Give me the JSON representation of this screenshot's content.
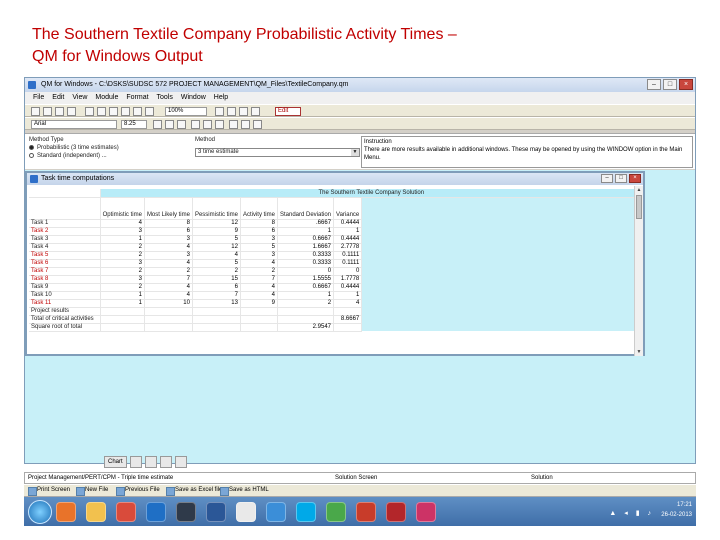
{
  "slide": {
    "title_line1": "The Southern Textile Company  Probabilistic Activity Times –",
    "title_line2": "QM for Windows Output"
  },
  "window": {
    "title": "QM for Windows - C:\\DSKS\\SUDSC 572 PROJECT MANAGEMENT\\QM_Files\\TextileCompany.qm"
  },
  "menu": [
    "File",
    "Edit",
    "View",
    "Module",
    "Format",
    "Tools",
    "Window",
    "Help"
  ],
  "toolbar": {
    "font_size": "100%",
    "font_name": "Arial",
    "font_pt": "8.25",
    "edit_label": "Edit"
  },
  "options": {
    "method_label": "Method Type",
    "radio1": "Probabilistic (3 time estimates)",
    "radio2": "Standard (independent) ...",
    "method_section_label": "Method",
    "method_value": "3 time estimate",
    "instruction_label": "Instruction",
    "instruction_text": "There are more results available in additional windows. These may be opened by using the WINDOW option in the Main Menu."
  },
  "inner_window": {
    "title": "Task time computations",
    "table_title": "The Southern Textile Company Solution"
  },
  "table": {
    "headers": [
      "Optimistic time",
      "Most Likely time",
      "Pessimistic time",
      "Activity time",
      "Standard Deviation",
      "Variance"
    ],
    "rows": [
      {
        "label": "Task 1",
        "cells": [
          "4",
          "8",
          "12",
          "8",
          ".6667",
          "0.4444"
        ],
        "red": false
      },
      {
        "label": "Task 2",
        "cells": [
          "3",
          "6",
          "9",
          "6",
          "1",
          "1"
        ],
        "red": true
      },
      {
        "label": "Task 3",
        "cells": [
          "1",
          "3",
          "5",
          "3",
          "0.6667",
          "0.4444"
        ],
        "red": false
      },
      {
        "label": "Task 4",
        "cells": [
          "2",
          "4",
          "12",
          "5",
          "1.6667",
          "2.7778"
        ],
        "red": false
      },
      {
        "label": "Task 5",
        "cells": [
          "2",
          "3",
          "4",
          "3",
          "0.3333",
          "0.1111"
        ],
        "red": true
      },
      {
        "label": "Task 6",
        "cells": [
          "3",
          "4",
          "5",
          "4",
          "0.3333",
          "0.1111"
        ],
        "red": true
      },
      {
        "label": "Task 7",
        "cells": [
          "2",
          "2",
          "2",
          "2",
          "0",
          "0"
        ],
        "red": true
      },
      {
        "label": "Task 8",
        "cells": [
          "3",
          "7",
          "15",
          "7",
          "1.5555",
          "1.7778"
        ],
        "red": true
      },
      {
        "label": "Task 9",
        "cells": [
          "2",
          "4",
          "6",
          "4",
          "0.6667",
          "0.4444"
        ],
        "red": false
      },
      {
        "label": "Task 10",
        "cells": [
          "1",
          "4",
          "7",
          "4",
          "1",
          "1"
        ],
        "red": false
      },
      {
        "label": "Task 11",
        "cells": [
          "1",
          "10",
          "13",
          "9",
          "2",
          "4"
        ],
        "red": true
      },
      {
        "label": "Project results",
        "cells": [
          "",
          "",
          "",
          "",
          "",
          ""
        ],
        "red": false
      },
      {
        "label": "Total of critical activities",
        "cells": [
          "",
          "",
          "",
          "",
          "",
          "8.6667"
        ],
        "red": false
      },
      {
        "label": "Square root of total",
        "cells": [
          "",
          "",
          "",
          "",
          "2.9547",
          ""
        ],
        "red": false
      }
    ]
  },
  "mini_tabs": [
    "Chart",
    "",
    "",
    "",
    ""
  ],
  "status_bar": {
    "left": "Project Management/PERT/CPM - Triple time estimate",
    "mid": "Solution Screen",
    "right": "Solution"
  },
  "bottom_tools": [
    "Print Screen",
    "New File",
    "Previous File",
    "Save as Excel file",
    "Save as HTML"
  ],
  "taskbar": {
    "time": "17:21",
    "date": "26-02-2013"
  }
}
